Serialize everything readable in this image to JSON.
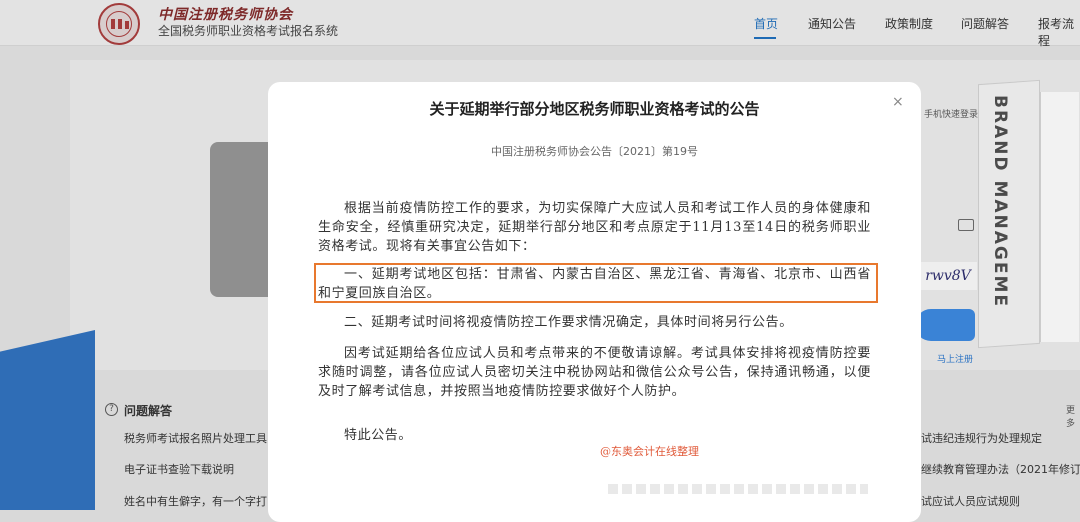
{
  "header": {
    "org_name": "中国注册税务师协会",
    "system_name": "全国税务师职业资格考试报名系统",
    "nav": [
      "首页",
      "通知公告",
      "政策制度",
      "问题解答",
      "报考流程"
    ]
  },
  "sidebar_login": {
    "quick_login": "手机快速登录",
    "captcha": "rwv8V",
    "register": "马上注册"
  },
  "book_cover_text": "BRAND MANAGEME",
  "faq": {
    "title": "问题解答",
    "more": "更多",
    "items_left": [
      "税务师考试报名照片处理工具",
      "电子证书查验下载说明",
      "姓名中有生僻字，有一个字打"
    ],
    "items_right": [
      "试违纪违规行为处理规定",
      "继续教育管理办法（2021年修订）",
      "试应试人员应试规则"
    ]
  },
  "modal": {
    "title": "关于延期举行部分地区税务师职业资格考试的公告",
    "close_glyph": "×",
    "subhead": "中国注册税务师协会公告〔2021〕第19号",
    "paragraphs": [
      "根据当前疫情防控工作的要求，为切实保障广大应试人员和考试工作人员的身体健康和生命安全，经慎重研究决定，延期举行部分地区和考点原定于11月13至14日的税务师职业资格考试。现将有关事宜公告如下：",
      "一、延期考试地区包括：甘肃省、内蒙古自治区、黑龙江省、青海省、北京市、山西省和宁夏回族自治区。",
      "二、延期考试时间将视疫情防控工作要求情况确定，具体时间将另行公告。",
      "因考试延期给各位应试人员和考点带来的不便敬请谅解。考试具体安排将视疫情防控要求随时调整，请各位应试人员密切关注中税协网站和微信公众号公告，保持通讯畅通，以便及时了解考试信息，并按照当地疫情防控要求做好个人防护。",
      "特此公告。"
    ],
    "watermark": "@东奥会计在线整理"
  },
  "colors": {
    "accent_blue": "#1f6bb5",
    "highlight_orange": "#e8782e",
    "logo_red": "#a23b3b"
  }
}
